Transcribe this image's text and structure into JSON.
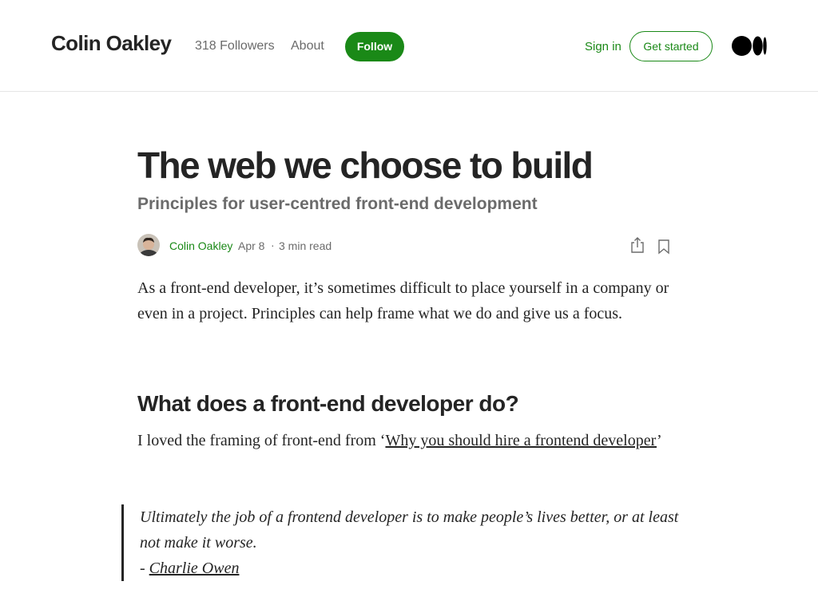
{
  "header": {
    "publication_name": "Colin Oakley",
    "followers": "318 Followers",
    "about": "About",
    "follow_label": "Follow",
    "sign_in": "Sign in",
    "get_started": "Get started",
    "logo_icon": "medium-logo-icon"
  },
  "article": {
    "title": "The web we choose to build",
    "subtitle": "Principles for user-centred front-end development",
    "author": "Colin Oakley",
    "date": "Apr 8",
    "separator": "·",
    "read_time": "3 min read",
    "intro": "As a front-end developer, it’s sometimes difficult to place yourself in a company or even in a project. Principles can help frame what we do and give us a focus.",
    "section_heading": "What does a front-end developer do?",
    "section_text_prefix": "I loved the framing of front-end from ‘",
    "section_link": "Why you should hire a frontend developer",
    "section_text_suffix": "’",
    "quote_text": "Ultimately the job of a frontend developer is to make people’s lives better, or at least not make it worse.",
    "quote_prefix": "- ",
    "quote_author": "Charlie Owen"
  },
  "colors": {
    "accent_green": "#1a8917",
    "text": "#242424",
    "muted": "#6b6b6b"
  }
}
